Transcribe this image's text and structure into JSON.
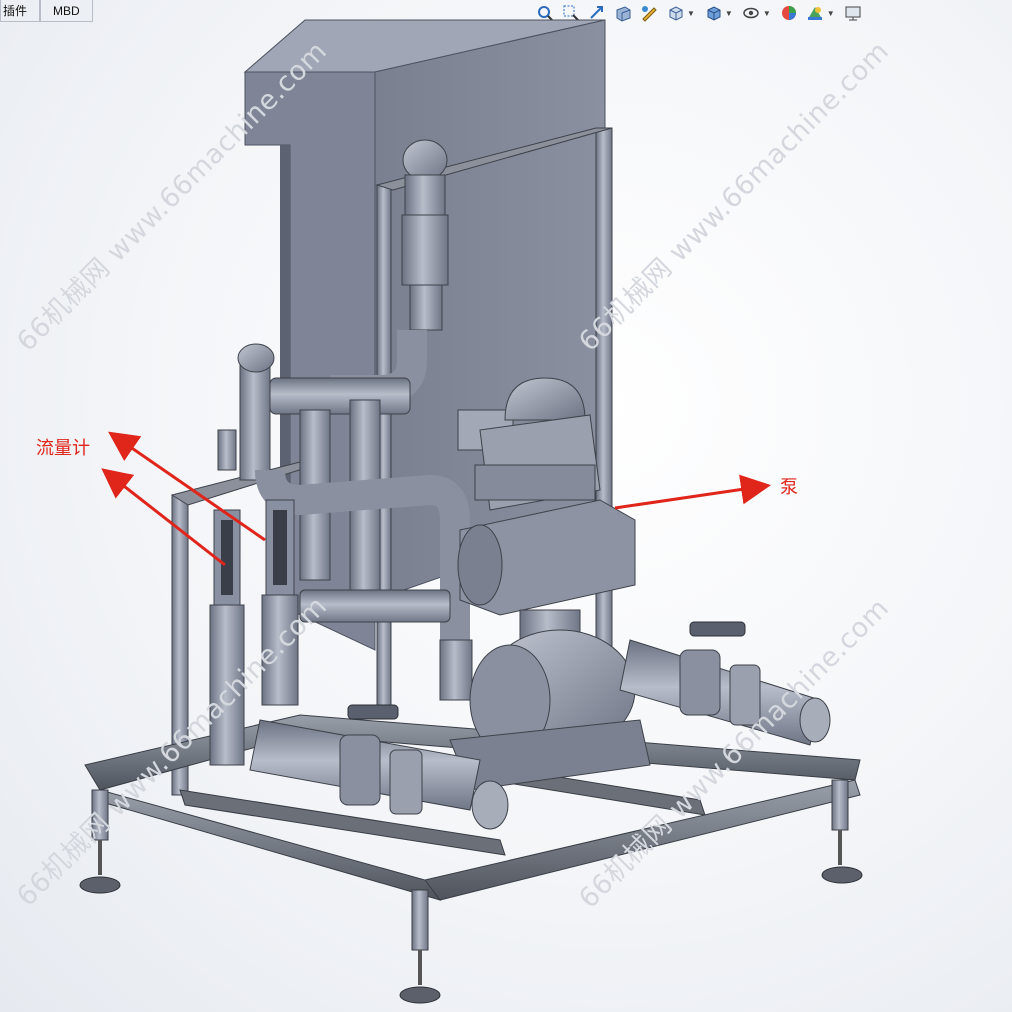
{
  "tabs": [
    "插件",
    "MBD"
  ],
  "toolbar_icons": [
    "zoom-to-fit-icon",
    "zoom-area-icon",
    "previous-view-icon",
    "section-view-icon",
    "dynamic-annotation-icon",
    "view-orientation-icon",
    "display-style-icon",
    "hide-show-items-icon",
    "edit-appearance-icon",
    "apply-scene-icon",
    "view-settings-icon"
  ],
  "callouts": {
    "flowmeter": "流量计",
    "pump": "泵"
  },
  "watermark": "66机械网 www.66machine.com",
  "colors": {
    "callout": "#e0251b",
    "part": "#8f96a6",
    "frame": "#6e737d",
    "panel": "#7d8394"
  }
}
